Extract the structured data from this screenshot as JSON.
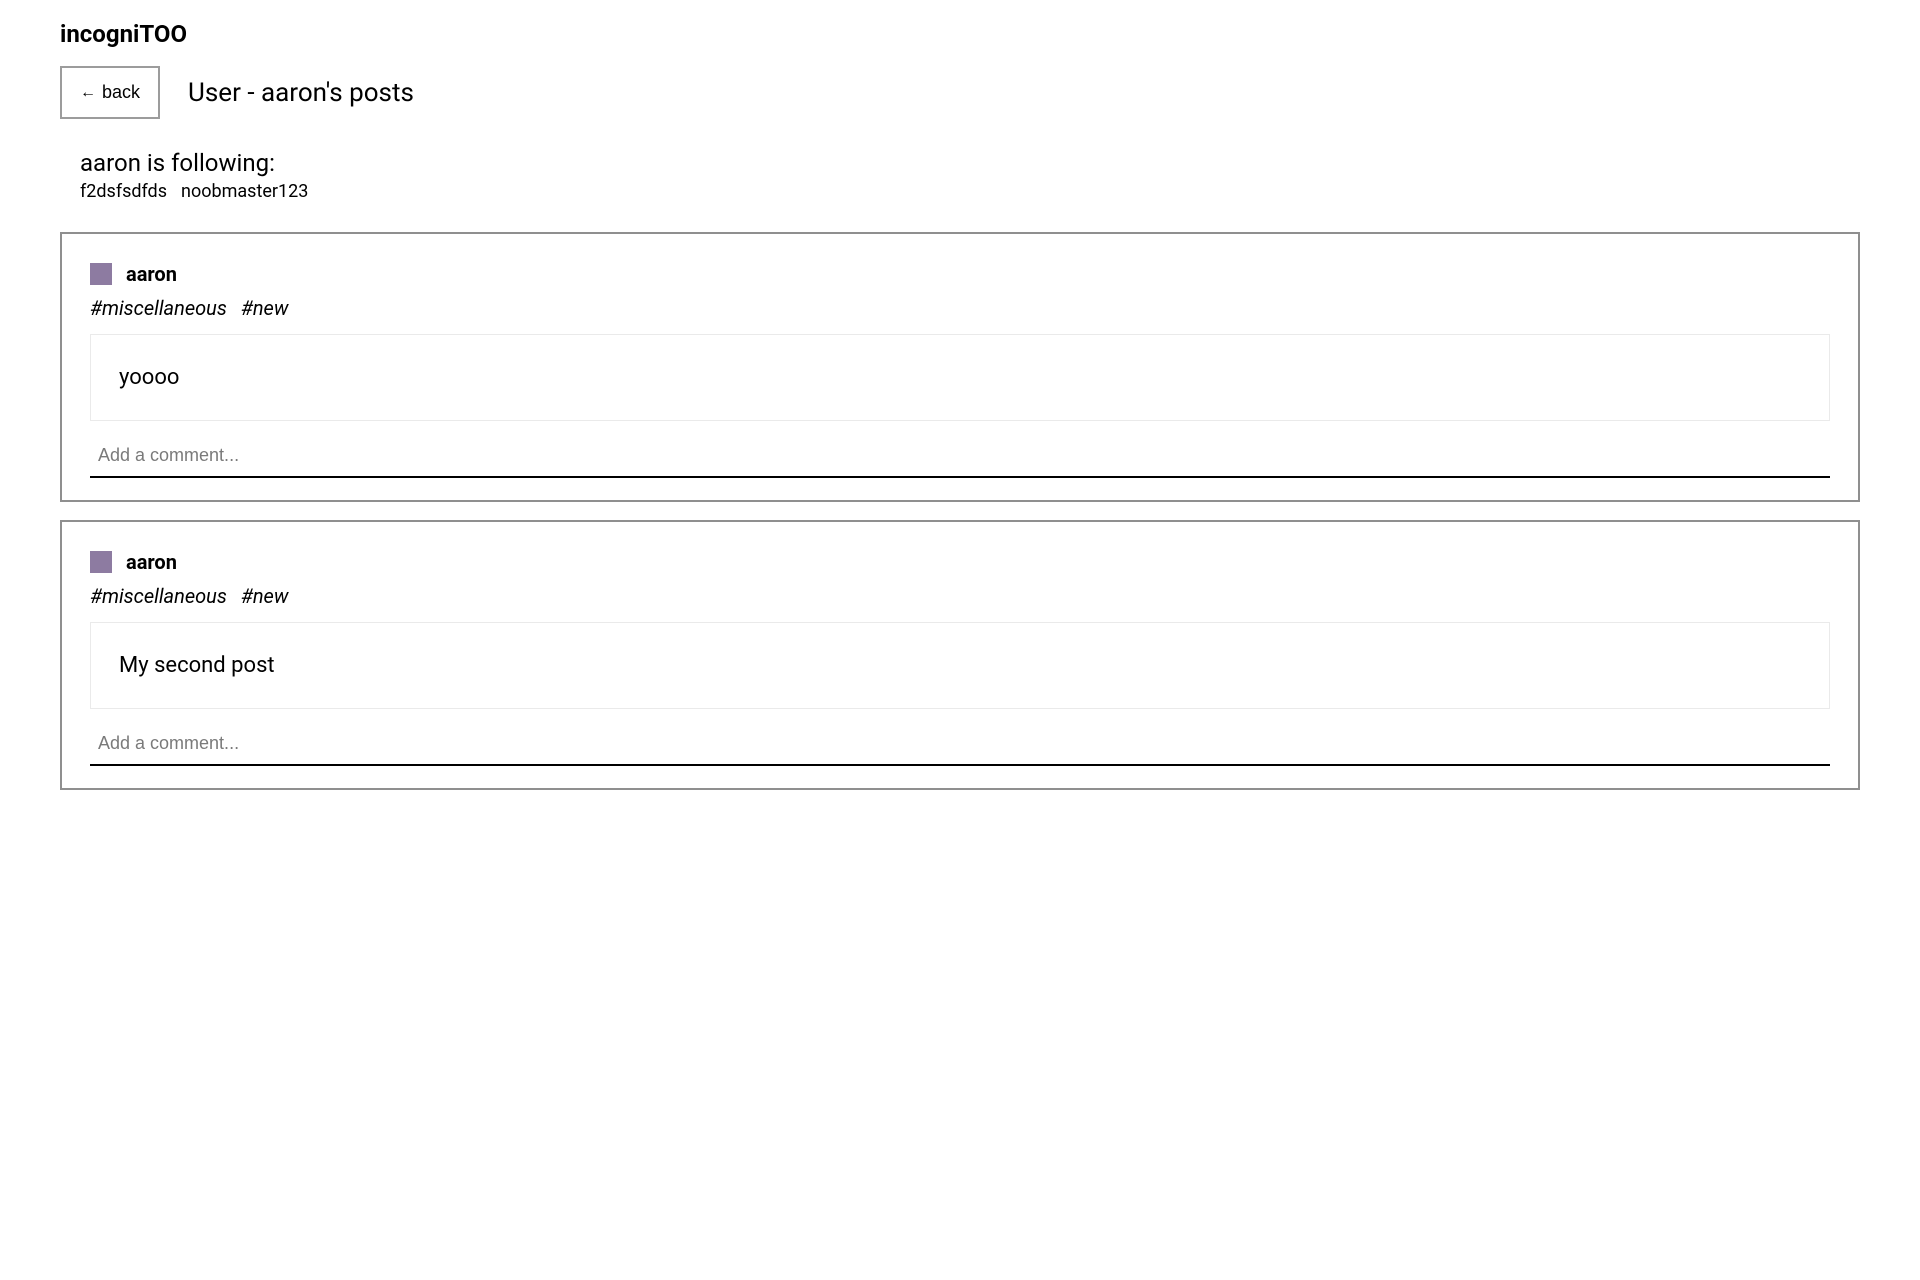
{
  "site": {
    "title": "incogniTOO"
  },
  "header": {
    "back_label": "back",
    "page_title": "User - aaron's posts"
  },
  "following": {
    "heading": "aaron is following:",
    "users": [
      "f2dsfsdfds",
      "noobmaster123"
    ]
  },
  "posts": [
    {
      "author": "aaron",
      "tags": [
        "#miscellaneous",
        "#new"
      ],
      "body": "yoooo",
      "comment_placeholder": "Add a comment..."
    },
    {
      "author": "aaron",
      "tags": [
        "#miscellaneous",
        "#new"
      ],
      "body": "My second post",
      "comment_placeholder": "Add a comment..."
    }
  ],
  "colors": {
    "avatar": "#8d7ba1",
    "card_border": "#8f8f8f",
    "body_border": "#eaeaea"
  }
}
